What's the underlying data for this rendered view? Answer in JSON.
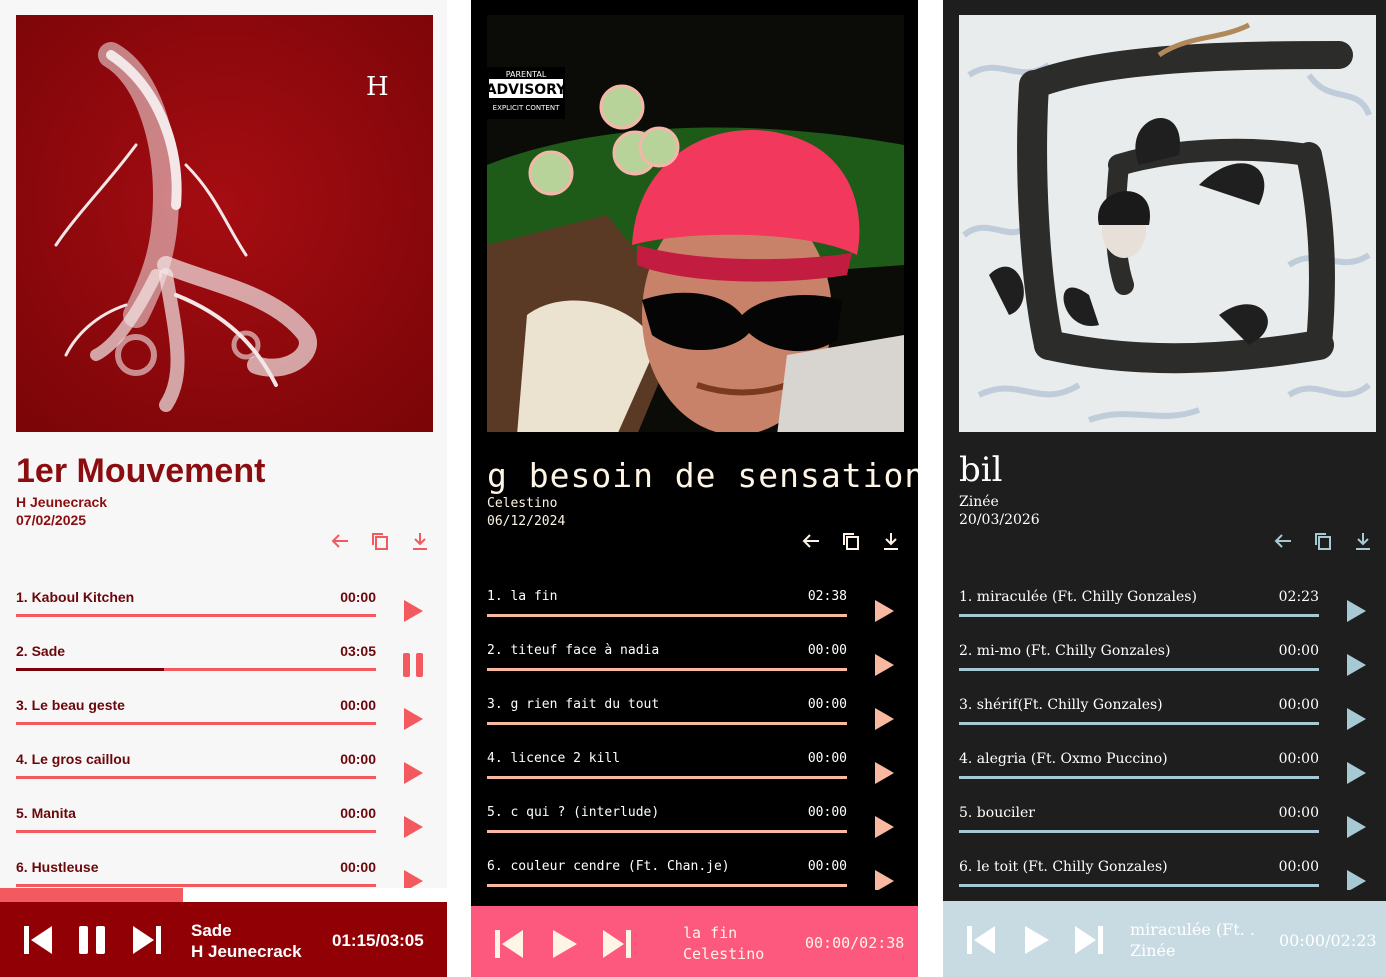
{
  "panels": [
    {
      "album_title": "1er Mouvement",
      "artist": "H Jeunecrack",
      "date": "07/02/2025",
      "cover_mark": "H",
      "tracks": [
        {
          "label": "1.  Kaboul Kitchen",
          "time": "00:00",
          "progress": 0,
          "state": "paused"
        },
        {
          "label": "2.  Sade",
          "time": "03:05",
          "progress": 0.41,
          "state": "playing"
        },
        {
          "label": "3.  Le beau geste",
          "time": "00:00",
          "progress": 0,
          "state": "paused"
        },
        {
          "label": "4.  Le gros caillou",
          "time": "00:00",
          "progress": 0,
          "state": "paused"
        },
        {
          "label": "5.  Manita",
          "time": "00:00",
          "progress": 0,
          "state": "paused"
        },
        {
          "label": "6.  Hustleuse",
          "time": "00:00",
          "progress": 0,
          "state": "paused"
        }
      ],
      "player": {
        "title": "Sade",
        "artist": "H Jeunecrack",
        "time": "01:15/03:05",
        "progress": 0.41,
        "state": "playing"
      },
      "colors": {
        "accent": "#f25a5f",
        "dark": "#900005"
      }
    },
    {
      "album_title": "g besoin de sensations",
      "artist": "Celestino",
      "date": "06/12/2024",
      "advisory": [
        "PARENTAL",
        "ADVISORY",
        "EXPLICIT CONTENT"
      ],
      "tracks": [
        {
          "label": "1.  la fin",
          "time": "02:38",
          "state": "paused"
        },
        {
          "label": "2.  titeuf face à nadia",
          "time": "00:00",
          "state": "paused"
        },
        {
          "label": "3.  g rien fait du tout",
          "time": "00:00",
          "state": "paused"
        },
        {
          "label": "4.  licence 2 kill",
          "time": "00:00",
          "state": "paused"
        },
        {
          "label": "5.  c qui ? (interlude)",
          "time": "00:00",
          "state": "paused"
        },
        {
          "label": "6.  couleur cendre (Ft. Chan.je)",
          "time": "00:00",
          "state": "paused"
        }
      ],
      "player": {
        "title": "la fin",
        "artist": "Celestino",
        "time": "00:00/02:38",
        "state": "paused"
      },
      "colors": {
        "accent": "#f9b8a0",
        "dark": "#fd587e"
      }
    },
    {
      "album_title": "bil",
      "artist": "Zinée",
      "date": "20/03/2026",
      "tracks": [
        {
          "label": "1.  miraculée (Ft. Chilly Gonzales)",
          "time": "02:23",
          "state": "paused"
        },
        {
          "label": "2.  mi-mo (Ft. Chilly Gonzales)",
          "time": "00:00",
          "state": "paused"
        },
        {
          "label": "3.  shérif(Ft. Chilly Gonzales)",
          "time": "00:00",
          "state": "paused"
        },
        {
          "label": "4.  alegria (Ft. Oxmo Puccino)",
          "time": "00:00",
          "state": "paused"
        },
        {
          "label": "5.  bouciler",
          "time": "00:00",
          "state": "paused"
        },
        {
          "label": "6.  le toit (Ft. Chilly Gonzales)",
          "time": "00:00",
          "state": "paused"
        }
      ],
      "player": {
        "title": "miraculée (Ft. .",
        "artist": "Zinée",
        "time": "00:00/02:23",
        "state": "paused"
      },
      "colors": {
        "accent": "#a6c9d4",
        "dark": "#c8dbe3"
      }
    }
  ],
  "icons": {
    "back": "arrow-left-icon",
    "copy": "copy-icon",
    "download": "download-icon",
    "play": "play-icon",
    "pause": "pause-icon",
    "prev": "skip-previous-icon",
    "next": "skip-next-icon"
  }
}
